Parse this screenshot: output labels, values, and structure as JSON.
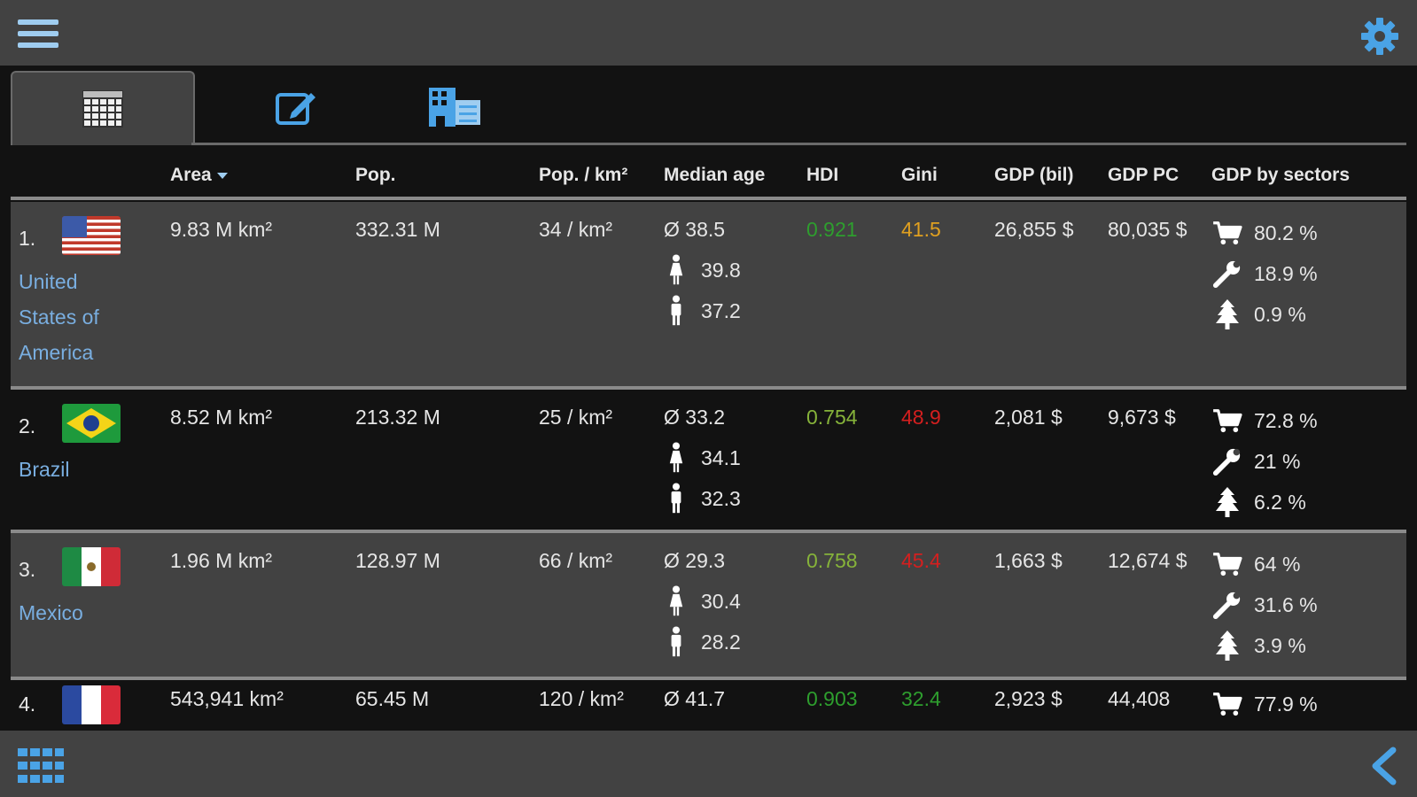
{
  "icons": {
    "menu": "hamburger-menu-icon",
    "settings": "gear-icon",
    "tab_table": "table-grid-icon",
    "tab_edit": "edit-icon",
    "tab_compare": "building-compare-icon",
    "bottom_grid": "app-grid-icon",
    "back": "chevron-left-icon"
  },
  "colors": {
    "accent": "#9fcdf0",
    "link": "#79aee0",
    "good": "#2e9e2e",
    "mid": "#86b33a",
    "warn": "#e0a020",
    "bad": "#d41f1f"
  },
  "columns": {
    "area": "Area",
    "pop": "Pop.",
    "density": "Pop. / km²",
    "median_age": "Median age",
    "hdi": "HDI",
    "gini": "Gini",
    "gdp": "GDP (bil)",
    "gdp_pc": "GDP PC",
    "gdp_sectors": "GDP by sectors"
  },
  "sort": {
    "column": "Area",
    "direction": "descending"
  },
  "countries": [
    {
      "rank": "1.",
      "name": "United States of America",
      "flag": "us-flag",
      "area": "9.83 M km²",
      "pop": "332.31 M",
      "density": "34 / km²",
      "median_avg": "Ø 38.5",
      "median_female": "39.8",
      "median_male": "37.2",
      "hdi": "0.921",
      "hdi_color": "#2e9e2e",
      "gini": "41.5",
      "gini_color": "#e0a020",
      "gdp": "26,855 $",
      "gdp_pc": "80,035 $",
      "sector_services": "80.2 %",
      "sector_industry": "18.9 %",
      "sector_agriculture": "0.9 %"
    },
    {
      "rank": "2.",
      "name": "Brazil",
      "flag": "br-flag",
      "area": "8.52 M km²",
      "pop": "213.32 M",
      "density": "25 / km²",
      "median_avg": "Ø 33.2",
      "median_female": "34.1",
      "median_male": "32.3",
      "hdi": "0.754",
      "hdi_color": "#86b33a",
      "gini": "48.9",
      "gini_color": "#d41f1f",
      "gdp": "2,081 $",
      "gdp_pc": "9,673 $",
      "sector_services": "72.8 %",
      "sector_industry": "21 %",
      "sector_agriculture": "6.2 %"
    },
    {
      "rank": "3.",
      "name": "Mexico",
      "flag": "mx-flag",
      "area": "1.96 M km²",
      "pop": "128.97 M",
      "density": "66 / km²",
      "median_avg": "Ø 29.3",
      "median_female": "30.4",
      "median_male": "28.2",
      "hdi": "0.758",
      "hdi_color": "#86b33a",
      "gini": "45.4",
      "gini_color": "#d41f1f",
      "gdp": "1,663 $",
      "gdp_pc": "12,674 $",
      "sector_services": "64 %",
      "sector_industry": "31.6 %",
      "sector_agriculture": "3.9 %"
    },
    {
      "rank": "4.",
      "name": "",
      "flag": "fr-flag",
      "area": "543,941 km²",
      "pop": "65.45 M",
      "density": "120 / km²",
      "median_avg": "Ø 41.7",
      "hdi": "0.903",
      "hdi_color": "#2e9e2e",
      "gini": "32.4",
      "gini_color": "#2e9e2e",
      "gdp": "2,923 $",
      "gdp_pc": "44,408",
      "sector_services": "77.9 %"
    }
  ]
}
